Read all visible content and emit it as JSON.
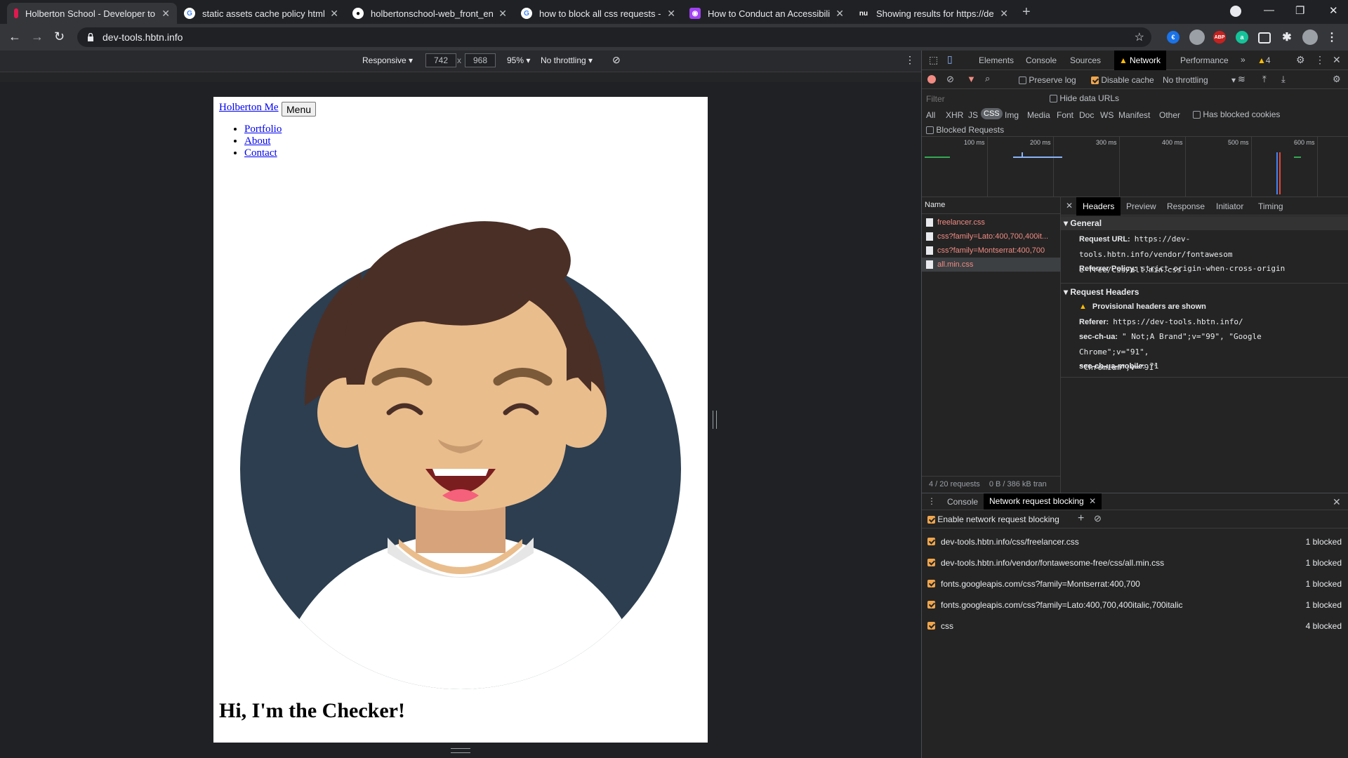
{
  "browser": {
    "tabs": [
      {
        "title": "Holberton School - Developer to",
        "favicon": "holberton-icon",
        "active": true
      },
      {
        "title": "static assets cache policy html - (",
        "favicon": "google-icon",
        "active": false
      },
      {
        "title": "holbertonschool-web_front_end/",
        "favicon": "github-icon",
        "active": false
      },
      {
        "title": "how to block all css requests - G",
        "favicon": "google-icon",
        "active": false
      },
      {
        "title": "How to Conduct an Accessibility",
        "favicon": "accessibility-icon",
        "active": false
      },
      {
        "title": "Showing results for https://dev-t",
        "favicon": "nu-icon",
        "active": false
      }
    ],
    "new_tab_label": "+",
    "url": "dev-tools.hbtn.info",
    "extensions": [
      {
        "name": "euro-extension-icon",
        "glyph": "€",
        "color": "#1a73e8"
      },
      {
        "name": "profile-extension-icon",
        "glyph": "",
        "color": "#9aa0a6"
      },
      {
        "name": "adblock-icon",
        "glyph": "ABP",
        "color": "#c5221f"
      },
      {
        "name": "grammarly-icon",
        "glyph": "a",
        "color": "#15c39a"
      }
    ]
  },
  "device_toolbar": {
    "mode": "Responsive",
    "width": "742",
    "height": "968",
    "times": "x",
    "zoom": "95%",
    "throttle": "No throttling"
  },
  "page": {
    "brand": "Holberton Me",
    "menu_button": "Menu",
    "nav": [
      "Portfolio",
      "About",
      "Contact"
    ],
    "heading": "Hi, I'm the Checker!"
  },
  "devtools": {
    "tabs": [
      "Elements",
      "Console",
      "Sources",
      "Network",
      "Performance"
    ],
    "active_tab": "Network",
    "warning_count": "4",
    "network_toolbar": {
      "preserve_log": "Preserve log",
      "disable_cache": "Disable cache",
      "throttle": "No throttling"
    },
    "filter": {
      "placeholder": "Filter",
      "hide_data_urls": "Hide data URLs",
      "types": [
        "All",
        "XHR",
        "JS",
        "CSS",
        "Img",
        "Media",
        "Font",
        "Doc",
        "WS",
        "Manifest",
        "Other"
      ],
      "active_type": "CSS",
      "has_blocked_cookies": "Has blocked cookies",
      "blocked_requests": "Blocked Requests"
    },
    "timeline_ticks": [
      "100 ms",
      "200 ms",
      "300 ms",
      "400 ms",
      "500 ms",
      "600 ms"
    ],
    "requests_header": "Name",
    "requests": [
      "freelancer.css",
      "css?family=Lato:400,700,400it...",
      "css?family=Montserrat:400,700",
      "all.min.css"
    ],
    "selected_request": 3,
    "status": {
      "requests": "4 / 20 requests",
      "transferred": "0 B / 386 kB tran"
    },
    "detail_tabs": [
      "Headers",
      "Preview",
      "Response",
      "Initiator",
      "Timing"
    ],
    "general": {
      "title": "General",
      "request_url_label": "Request URL:",
      "request_url_line1": "https://dev-tools.hbtn.info/vendor/fontawesom",
      "request_url_line2": "e-free/css/all.min.css",
      "referrer_policy_label": "Referrer Policy:",
      "referrer_policy": "strict-origin-when-cross-origin"
    },
    "request_headers": {
      "title": "Request Headers",
      "provisional": "Provisional headers are shown",
      "referer_label": "Referer:",
      "referer": "https://dev-tools.hbtn.info/",
      "sec_ch_ua_label": "sec-ch-ua:",
      "sec_ch_ua_line1": "\" Not;A Brand\";v=\"99\", \"Google Chrome\";v=\"91\",",
      "sec_ch_ua_line2": "\"Chromium\";v=\"91\"",
      "sec_ch_ua_mobile_label": "sec-ch-ua-mobile:",
      "sec_ch_ua_mobile": "?1"
    },
    "drawer": {
      "tabs": [
        "Console",
        "Network request blocking"
      ],
      "active_tab": "Network request blocking",
      "enable_label": "Enable network request blocking",
      "patterns": [
        {
          "pattern": "dev-tools.hbtn.info/css/freelancer.css",
          "count": "1 blocked"
        },
        {
          "pattern": "dev-tools.hbtn.info/vendor/fontawesome-free/css/all.min.css",
          "count": "1 blocked"
        },
        {
          "pattern": "fonts.googleapis.com/css?family=Montserrat:400,700",
          "count": "1 blocked"
        },
        {
          "pattern": "fonts.googleapis.com/css?family=Lato:400,700,400italic,700italic",
          "count": "1 blocked"
        },
        {
          "pattern": "css",
          "count": "4 blocked"
        }
      ]
    }
  },
  "colors": {
    "tab_bar": "#202124",
    "active_tab": "#35363a",
    "blocked_request": "#f28b82",
    "checkbox_accent": "#f0a64c",
    "avatar_circle": "#2c3e50",
    "hair": "#4a2f27",
    "skin": "#eabd8c"
  }
}
